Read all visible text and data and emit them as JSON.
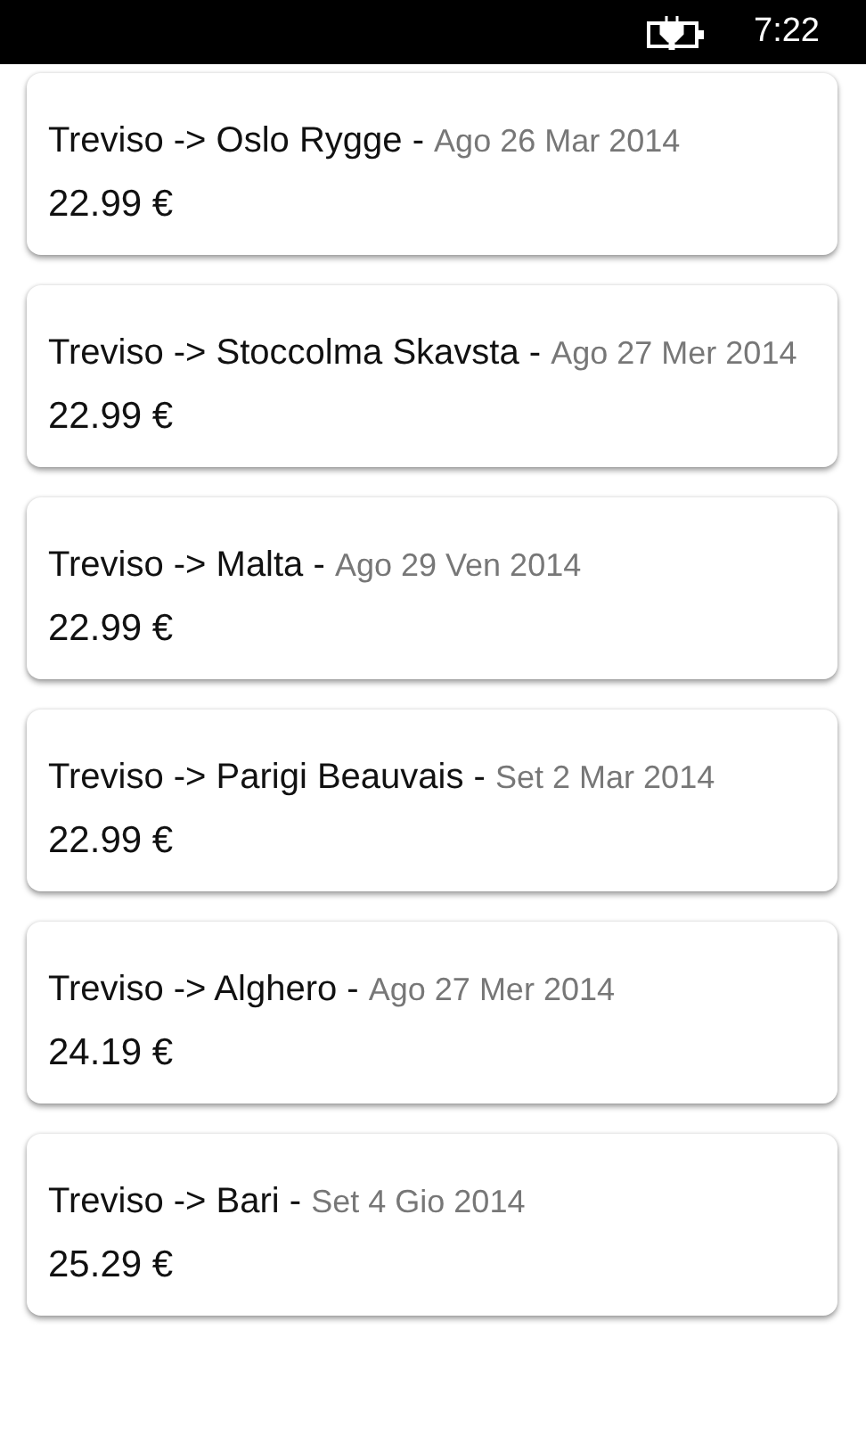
{
  "status_bar": {
    "charging": true,
    "time": "7:22"
  },
  "flights": [
    {
      "route": "Treviso -> Oslo Rygge - ",
      "date": "Ago 26 Mar 2014",
      "price": "22.99 €"
    },
    {
      "route": "Treviso -> Stoccolma Skavsta - ",
      "date": "Ago 27 Mer 2014",
      "price": "22.99 €"
    },
    {
      "route": "Treviso -> Malta - ",
      "date": "Ago 29 Ven 2014",
      "price": "22.99 €"
    },
    {
      "route": "Treviso -> Parigi Beauvais - ",
      "date": "Set 2 Mar 2014",
      "price": "22.99 €"
    },
    {
      "route": "Treviso -> Alghero - ",
      "date": "Ago 27 Mer 2014",
      "price": "24.19 €"
    },
    {
      "route": "Treviso -> Bari - ",
      "date": "Set 4 Gio 2014",
      "price": "25.29 €"
    }
  ]
}
